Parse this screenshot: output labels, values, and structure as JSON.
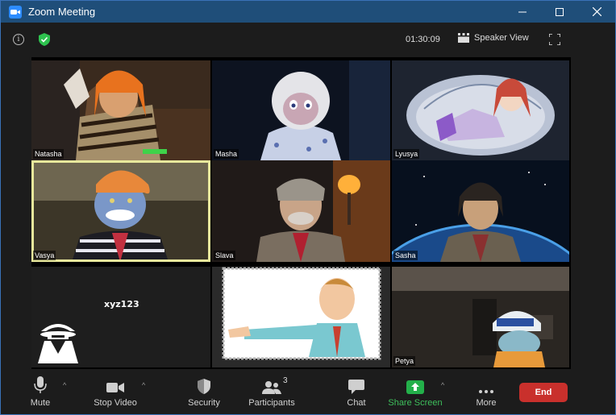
{
  "window": {
    "title": "Zoom Meeting"
  },
  "topbar": {
    "timer": "01:30:09",
    "view_label": "Speaker View"
  },
  "participants_tiles": [
    {
      "name": "Natasha"
    },
    {
      "name": "Masha"
    },
    {
      "name": "Lyusya"
    },
    {
      "name": "Vasya"
    },
    {
      "name": "Slava"
    },
    {
      "name": "Sasha"
    },
    {
      "name": "xyz123"
    },
    {
      "name": ""
    },
    {
      "name": "Petya"
    }
  ],
  "toolbar": {
    "mute": "Mute",
    "stop_video": "Stop Video",
    "security": "Security",
    "participants": "Participants",
    "participants_count": "3",
    "chat": "Chat",
    "share_screen": "Share Screen",
    "more": "More",
    "end": "End"
  },
  "colors": {
    "accent_green": "#3ebf5c",
    "end_red": "#c9302c",
    "title_bar": "#1f4e79",
    "active_speaker": "#e8e89c"
  }
}
